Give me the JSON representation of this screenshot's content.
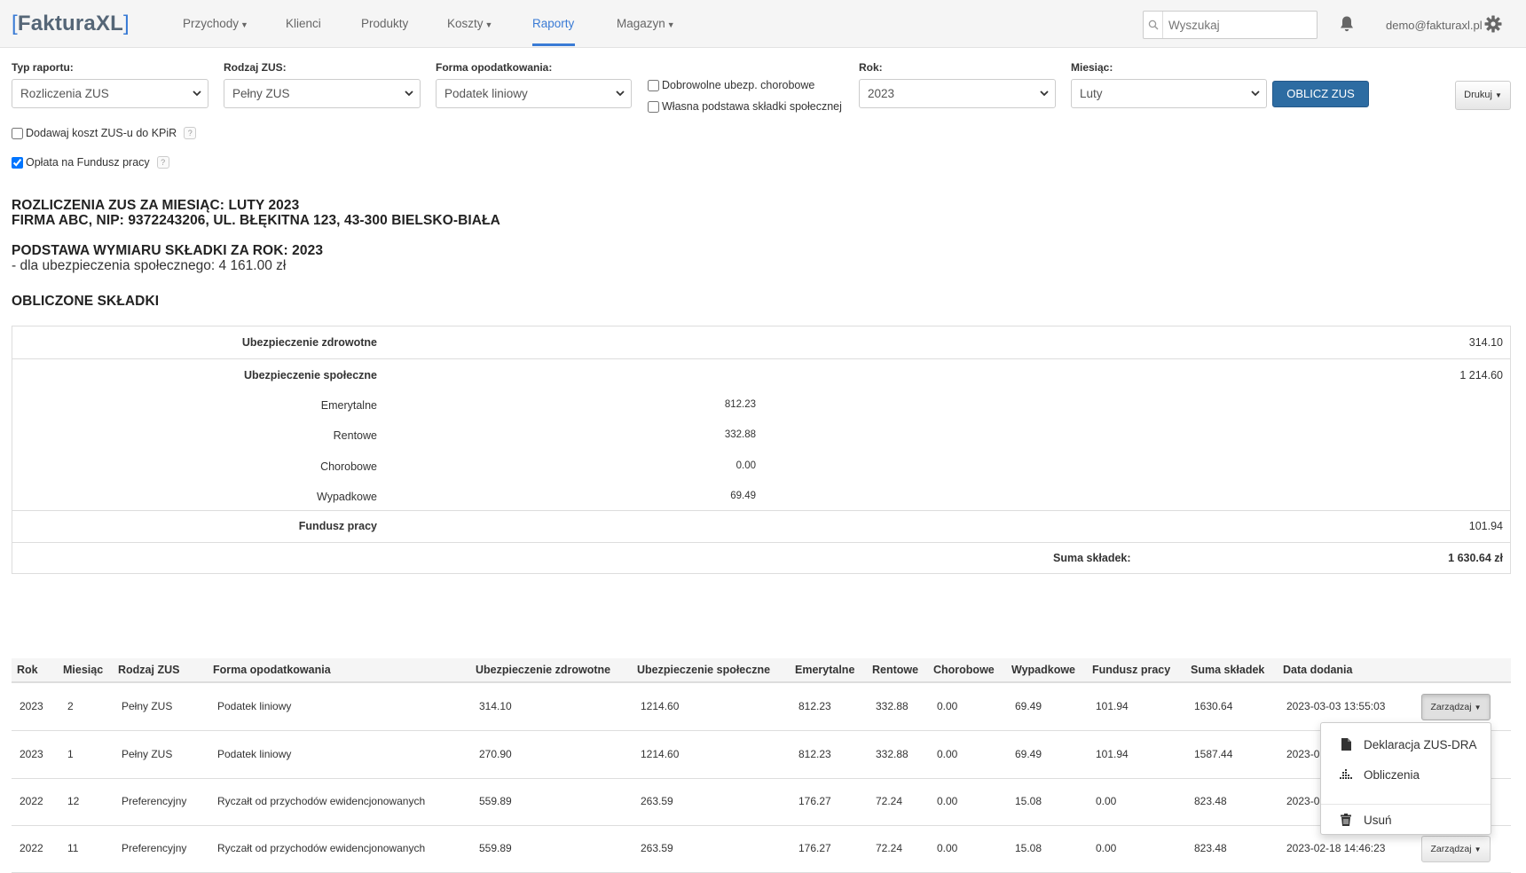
{
  "header": {
    "logo_open": "[",
    "logo_text": "FakturaXL",
    "logo_close": "]",
    "nav": [
      {
        "label": "Przychody",
        "dropdown": true
      },
      {
        "label": "Klienci",
        "dropdown": false
      },
      {
        "label": "Produkty",
        "dropdown": false
      },
      {
        "label": "Koszty",
        "dropdown": true
      },
      {
        "label": "Raporty",
        "dropdown": false,
        "active": true
      },
      {
        "label": "Magazyn",
        "dropdown": true
      }
    ],
    "search_placeholder": "Wyszukaj",
    "user_email": "demo@fakturaxl.pl"
  },
  "filters": {
    "report_type": {
      "label": "Typ raportu:",
      "value": "Rozliczenia ZUS"
    },
    "zus_type": {
      "label": "Rodzaj ZUS:",
      "value": "Pełny ZUS"
    },
    "tax_form": {
      "label": "Forma opodatkowania:",
      "value": "Podatek liniowy"
    },
    "voluntary_sickness": {
      "label": "Dobrowolne ubezp. chorobowe",
      "checked": false
    },
    "own_base": {
      "label": "Własna podstawa składki społecznej",
      "checked": false
    },
    "year": {
      "label": "Rok:",
      "value": "2023"
    },
    "month": {
      "label": "Miesiąc:",
      "value": "Luty"
    },
    "calc_button": "OBLICZ ZUS",
    "print_button": "Drukuj",
    "add_cost": {
      "label": "Dodawaj koszt ZUS-u do KPiR",
      "checked": false
    },
    "labor_fund": {
      "label": "Opłata na Fundusz pracy",
      "checked": true
    },
    "help_mark": "?"
  },
  "report": {
    "title_line1": "ROZLICZENIA ZUS ZA MIESIĄC: LUTY 2023",
    "title_line2": "FIRMA ABC, NIP: 9372243206, UL. BŁĘKITNA 123, 43-300 BIELSKO-BIAŁA",
    "base_title": "PODSTAWA WYMIARU SKŁADKI ZA ROK: 2023",
    "base_social": "- dla ubezpieczenia społecznego: 4 161.00 zł",
    "computed_title": "OBLICZONE SKŁADKI"
  },
  "summary": {
    "health": {
      "label": "Ubezpieczenie zdrowotne",
      "value": "314.10"
    },
    "social": {
      "label": "Ubezpieczenie społeczne",
      "value": "1 214.60"
    },
    "pension": {
      "label": "Emerytalne",
      "value": "812.23"
    },
    "disability": {
      "label": "Rentowe",
      "value": "332.88"
    },
    "sickness": {
      "label": "Chorobowe",
      "value": "0.00"
    },
    "accident": {
      "label": "Wypadkowe",
      "value": "69.49"
    },
    "labor_fund": {
      "label": "Fundusz pracy",
      "value": "101.94"
    },
    "total": {
      "label": "Suma składek:",
      "value": "1 630.64 zł"
    }
  },
  "table": {
    "headers": [
      "Rok",
      "Miesiąc",
      "Rodzaj ZUS",
      "Forma opodatkowania",
      "Ubezpieczenie zdrowotne",
      "Ubezpieczenie społeczne",
      "Emerytalne",
      "Rentowe",
      "Chorobowe",
      "Wypadkowe",
      "Fundusz pracy",
      "Suma składek",
      "Data dodania"
    ],
    "manage_label": "Zarządzaj",
    "rows": [
      [
        "2023",
        "2",
        "Pełny ZUS",
        "Podatek liniowy",
        "314.10",
        "1214.60",
        "812.23",
        "332.88",
        "0.00",
        "69.49",
        "101.94",
        "1630.64",
        "2023-03-03 13:55:03"
      ],
      [
        "2023",
        "1",
        "Pełny ZUS",
        "Podatek liniowy",
        "270.90",
        "1214.60",
        "812.23",
        "332.88",
        "0.00",
        "69.49",
        "101.94",
        "1587.44",
        "2023-0"
      ],
      [
        "2022",
        "12",
        "Preferencyjny",
        "Ryczałt od przychodów ewidencjonowanych",
        "559.89",
        "263.59",
        "176.27",
        "72.24",
        "0.00",
        "15.08",
        "0.00",
        "823.48",
        "2023-0"
      ],
      [
        "2022",
        "11",
        "Preferencyjny",
        "Ryczałt od przychodów ewidencjonowanych",
        "559.89",
        "263.59",
        "176.27",
        "72.24",
        "0.00",
        "15.08",
        "0.00",
        "823.48",
        "2023-02-18 14:46:23"
      ]
    ]
  },
  "dropdown_menu": {
    "items": [
      {
        "label": "Deklaracja ZUS-DRA",
        "icon": "file-icon"
      },
      {
        "label": "Obliczenia",
        "icon": "chart-icon"
      },
      {
        "label": "Usuń",
        "icon": "trash-icon"
      }
    ]
  },
  "colors": {
    "accent": "#3a7bd5",
    "primary_button": "#2d6ca2"
  }
}
